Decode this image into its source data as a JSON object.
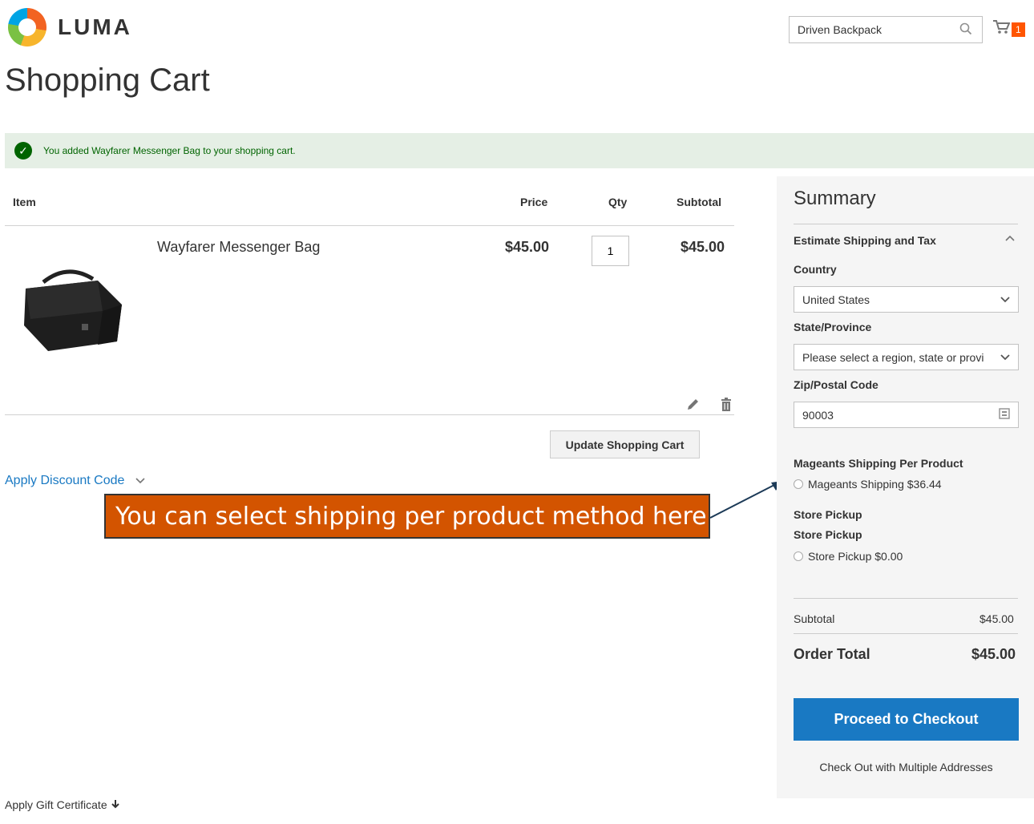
{
  "header": {
    "logo_text": "LUMA",
    "search_value": "Driven Backpack",
    "cart_count": "1"
  },
  "page": {
    "title": "Shopping Cart",
    "message": "You added Wayfarer Messenger Bag to your shopping cart."
  },
  "cart": {
    "columns": [
      "Item",
      "Price",
      "Qty",
      "Subtotal"
    ],
    "items": [
      {
        "name": "Wayfarer Messenger Bag",
        "price": "$45.00",
        "qty": "1",
        "subtotal": "$45.00"
      }
    ],
    "update_label": "Update Shopping Cart",
    "discount_label": "Apply Discount Code",
    "gift_label": "Apply Gift Certificate"
  },
  "annotation": {
    "text": "You can select shipping per product method here"
  },
  "summary": {
    "title": "Summary",
    "estimate_title": "Estimate Shipping and Tax",
    "country_label": "Country",
    "country_value": "United States",
    "state_label": "State/Province",
    "state_value": "Please select a region, state or provi",
    "zip_label": "Zip/Postal Code",
    "zip_value": "90003",
    "carriers": [
      {
        "title": "Mageants Shipping Per Product",
        "method": "",
        "option": "Mageants Shipping $36.44"
      },
      {
        "title": "Store Pickup",
        "method": "Store Pickup",
        "option": "Store Pickup $0.00"
      }
    ],
    "subtotal_label": "Subtotal",
    "subtotal_value": "$45.00",
    "total_label": "Order Total",
    "total_value": "$45.00",
    "checkout_label": "Proceed to Checkout",
    "multi_label": "Check Out with Multiple Addresses"
  },
  "colors": {
    "primary": "#1979c3",
    "success": "#006400",
    "callout": "#d35400"
  }
}
